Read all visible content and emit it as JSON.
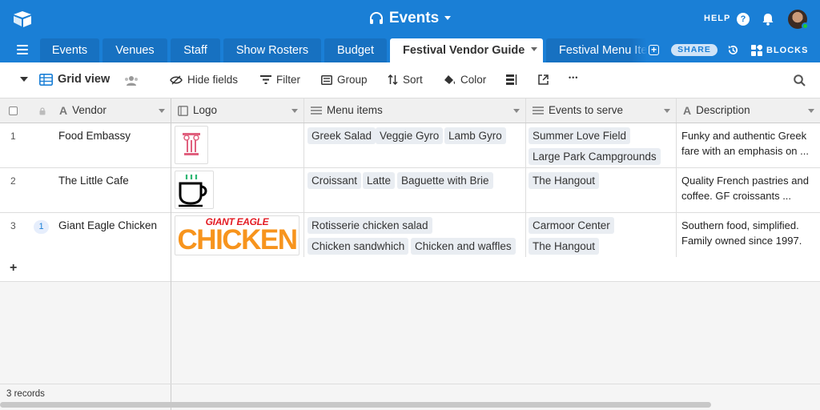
{
  "header": {
    "base_title": "Events",
    "help_label": "HELP",
    "help_icon_glyph": "?"
  },
  "tabs": [
    {
      "label": "Events"
    },
    {
      "label": "Venues"
    },
    {
      "label": "Staff"
    },
    {
      "label": "Show Rosters"
    },
    {
      "label": "Budget"
    },
    {
      "label": "Festival Vendor Guide",
      "active": true
    },
    {
      "label": "Festival Menu Items"
    }
  ],
  "tabbar": {
    "share_label": "SHARE",
    "blocks_label": "BLOCKS"
  },
  "toolbar": {
    "view_name": "Grid view",
    "hide_fields": "Hide fields",
    "filter": "Filter",
    "group": "Group",
    "sort": "Sort",
    "color": "Color",
    "more_glyph": "•••"
  },
  "columns": [
    {
      "name": "Vendor",
      "type_icon": "text-type-icon"
    },
    {
      "name": "Logo",
      "type_icon": "attachment-type-icon"
    },
    {
      "name": "Menu items",
      "type_icon": "link-type-icon"
    },
    {
      "name": "Events to serve",
      "type_icon": "link-type-icon"
    },
    {
      "name": "Description",
      "type_icon": "text-type-icon"
    }
  ],
  "rows": [
    {
      "num": "1",
      "vendor": "Food Embassy",
      "logo": "food-embassy-logo",
      "menu_items": [
        "Greek Salad",
        "Veggie Gyro",
        "Lamb Gyro"
      ],
      "events": [
        "Summer Love Field",
        "Large Park Campgrounds"
      ],
      "description": "Funky and authentic Greek fare with an emphasis on ..."
    },
    {
      "num": "2",
      "vendor": "The Little Cafe",
      "logo": "coffee-cup-logo",
      "menu_items": [
        "Croissant",
        "Latte",
        "Baguette with Brie"
      ],
      "events": [
        "The Hangout"
      ],
      "description": "Quality French pastries and coffee. GF croissants ..."
    },
    {
      "num": "3",
      "comment_count": "1",
      "vendor": "Giant Eagle Chicken",
      "logo": "giant-eagle-chicken-logo",
      "logo_text_top": "GIANT EAGLE",
      "logo_text_main": "CHICKEN",
      "menu_items": [
        "Rotisserie chicken salad",
        "Chicken sandwhich",
        "Chicken and waffles"
      ],
      "events": [
        "Carmoor Center",
        "The Hangout"
      ],
      "description": "Southern food, simplified. Family owned since 1997."
    }
  ],
  "add_row_glyph": "+",
  "footer": {
    "record_count": "3 records"
  },
  "colors": {
    "brand_blue": "#1a7fd6",
    "tab_inactive": "#1771c1",
    "pill_bg": "#e9edf2",
    "status_green": "#20c933"
  }
}
